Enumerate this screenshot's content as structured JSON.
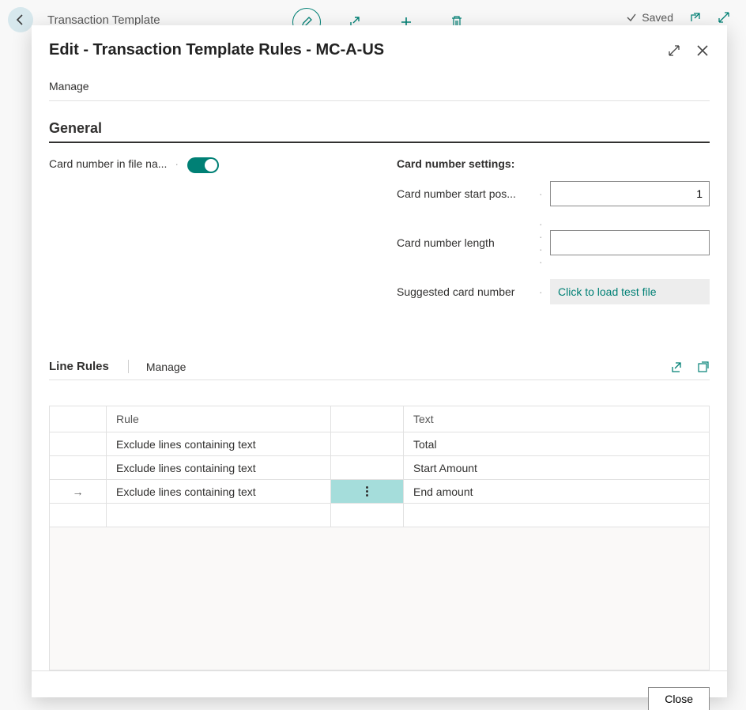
{
  "bg": {
    "title": "Transaction Template",
    "saved": "Saved"
  },
  "modal": {
    "title": "Edit - Transaction Template Rules - MC-A-US",
    "manage": "Manage",
    "close": "Close"
  },
  "general": {
    "title": "General",
    "card_in_file_label": "Card number in file na...",
    "card_in_file_on": true,
    "right_head": "Card number settings:",
    "start_pos_label": "Card number start pos...",
    "start_pos_value": "1",
    "length_label": "Card number length",
    "length_value": "",
    "sugg_label": "Suggested card number",
    "sugg_link": "Click to load test file"
  },
  "linerules": {
    "title": "Line Rules",
    "manage": "Manage",
    "columns": {
      "rule": "Rule",
      "text": "Text"
    },
    "rows": [
      {
        "rule": "Exclude lines containing text",
        "text": "Total",
        "selected": false
      },
      {
        "rule": "Exclude lines containing text",
        "text": "Start Amount",
        "selected": false
      },
      {
        "rule": "Exclude lines containing text",
        "text": "End amount",
        "selected": true
      }
    ]
  }
}
